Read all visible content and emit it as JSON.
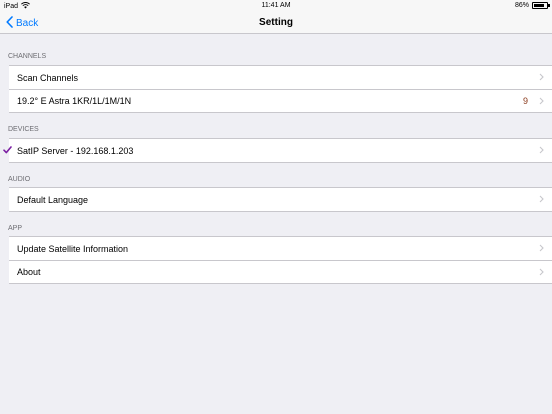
{
  "status_bar": {
    "device": "iPad",
    "time": "11:41 AM",
    "battery": "86%",
    "battery_level": 0.86
  },
  "nav": {
    "back_label": "Back",
    "title": "Setting"
  },
  "sections": {
    "channels": {
      "header": "CHANNELS",
      "items": [
        {
          "label": "Scan Channels"
        },
        {
          "label": "19.2° E Astra 1KR/1L/1M/1N",
          "detail": "9"
        }
      ]
    },
    "devices": {
      "header": "DEVICES",
      "items": [
        {
          "label": "SatIP Server - 192.168.1.203",
          "checked": true
        }
      ]
    },
    "audio": {
      "header": "AUDIO",
      "items": [
        {
          "label": "Default Language"
        }
      ]
    },
    "app": {
      "header": "APP",
      "items": [
        {
          "label": "Update Satellite Information"
        },
        {
          "label": "About"
        }
      ]
    }
  },
  "colors": {
    "accent": "#007aff",
    "checkmark": "#7b1fa2",
    "detail": "#8a3a1c",
    "background": "#efeff4"
  }
}
